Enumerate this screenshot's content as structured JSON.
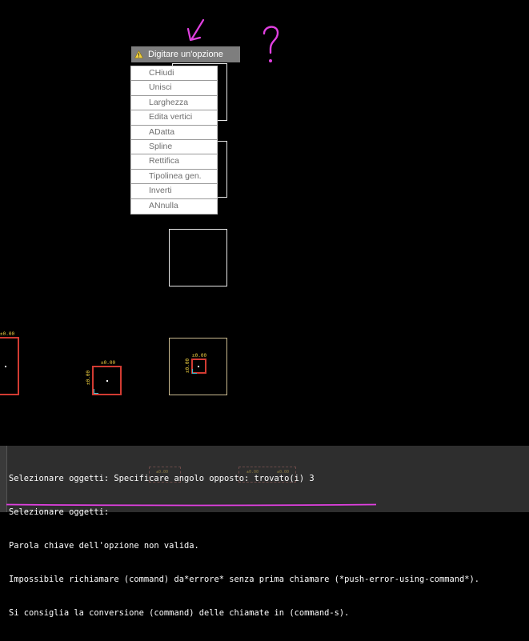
{
  "prompt": {
    "label": "Digitare un'opzione",
    "icon": "warning-icon"
  },
  "menu": {
    "items": [
      {
        "label": "CHiudi"
      },
      {
        "label": "Unisci"
      },
      {
        "label": "Larghezza"
      },
      {
        "label": "Edita vertici"
      },
      {
        "label": "ADatta"
      },
      {
        "label": "Spline"
      },
      {
        "label": "Rettifica"
      },
      {
        "label": "Tipolinea gen."
      },
      {
        "label": "Inverti"
      },
      {
        "label": "ANnulla"
      }
    ]
  },
  "annotations": {
    "question_mark": "?",
    "color": "#e040e0"
  },
  "drawing": {
    "dim_labels": {
      "left_top": "±0.00",
      "mid_top": "±0.00",
      "mid_side": "±0.00",
      "right_top": "±0.00",
      "right_side": "±0.00"
    },
    "colors": {
      "white": "#e8e8e8",
      "tan": "#c9b98f",
      "red": "#d23b32",
      "dim": "#f0d040"
    }
  },
  "command_line": {
    "lines": [
      "Selezionare oggetti: Specificare angolo opposto: trovato(i) 3",
      "Selezionare oggetti:",
      "Parola chiave dell'opzione non valida.",
      "Impossibile richiamare (command) da*errore* senza prima chiamare (*push-error-using-command*).",
      "Si consiglia la conversione (command) delle chiamate in (command-s)."
    ],
    "ghost_labels": [
      "±0.00",
      "±0.00",
      "±0.00"
    ]
  }
}
